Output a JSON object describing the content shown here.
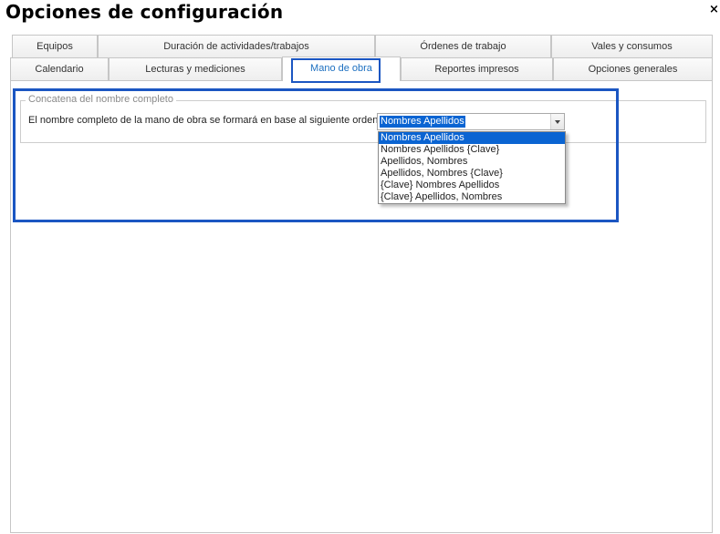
{
  "window": {
    "title": "Opciones de configuración",
    "close_symbol": "×"
  },
  "tabs": {
    "row1": [
      {
        "label": "Equipos"
      },
      {
        "label": "Duración de actividades/trabajos"
      },
      {
        "label": "Órdenes de trabajo"
      },
      {
        "label": "Vales y consumos"
      }
    ],
    "row2": [
      {
        "label": "Calendario"
      },
      {
        "label": "Lecturas y mediciones"
      },
      {
        "label": "Mano de obra",
        "active": true
      },
      {
        "label": "Reportes impresos"
      },
      {
        "label": "Opciones generales"
      }
    ]
  },
  "group": {
    "legend": "Concatena del nombre completo",
    "field_label": "El nombre completo de la mano de obra se formará en base al siguiente orden:",
    "combo": {
      "value": "Nombres Apellidos",
      "options": [
        "Nombres Apellidos",
        "Nombres Apellidos {Clave}",
        "Apellidos, Nombres",
        "Apellidos, Nombres {Clave}",
        "{Clave} Nombres Apellidos",
        "{Clave} Apellidos, Nombres"
      ],
      "selected_index": 0
    }
  },
  "colors": {
    "highlight": "#1b56c2",
    "selection": "#0a64d2",
    "active_tab_text": "#1c6fc0"
  },
  "icons": {
    "close": "close-icon",
    "dropdown": "chevron-down-icon"
  }
}
